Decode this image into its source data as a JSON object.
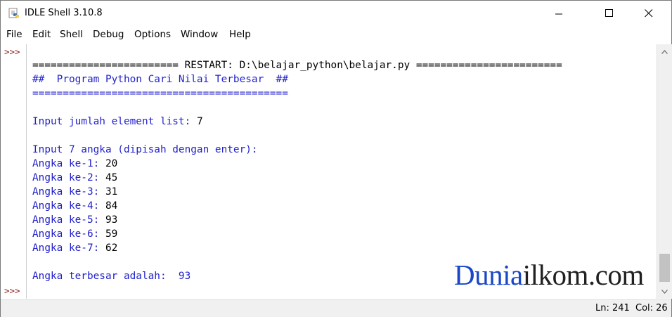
{
  "window": {
    "title": "IDLE Shell 3.10.8",
    "controls": {
      "minimize": "minimize-icon",
      "maximize": "maximize-icon",
      "close": "close-icon"
    }
  },
  "menu": [
    "File",
    "Edit",
    "Shell",
    "Debug",
    "Options",
    "Window",
    "Help"
  ],
  "gutter": {
    "prompts": [
      ">>>",
      ">>>"
    ]
  },
  "shell": {
    "lines": [
      {
        "text": "======================== RESTART: D:\\belajar_python\\belajar.py ========================",
        "color": "black"
      },
      {
        "text": "##  Program Python Cari Nilai Terbesar  ##",
        "color": "blue"
      },
      {
        "text": "==========================================",
        "color": "blue"
      },
      {
        "text": "",
        "color": "black"
      },
      {
        "prompt": "Input jumlah element list: ",
        "value": "7"
      },
      {
        "text": "",
        "color": "black"
      },
      {
        "text": "Input 7 angka (dipisah dengan enter):",
        "color": "blue"
      },
      {
        "prompt": "Angka ke-1: ",
        "value": "20"
      },
      {
        "prompt": "Angka ke-2: ",
        "value": "45"
      },
      {
        "prompt": "Angka ke-3: ",
        "value": "31"
      },
      {
        "prompt": "Angka ke-4: ",
        "value": "84"
      },
      {
        "prompt": "Angka ke-5: ",
        "value": "93"
      },
      {
        "prompt": "Angka ke-6: ",
        "value": "59"
      },
      {
        "prompt": "Angka ke-7: ",
        "value": "62"
      },
      {
        "text": "",
        "color": "black"
      },
      {
        "text": "Angka terbesar adalah:  93",
        "color": "blue"
      }
    ]
  },
  "watermark": {
    "part1": "Dunia",
    "part2": "ilkom.com"
  },
  "status": {
    "line": "Ln: 241",
    "col": "Col: 26"
  },
  "colors": {
    "output_blue": "#2222cc",
    "prompt_red": "#8a1c1c",
    "brand_blue": "#1a47c8"
  }
}
